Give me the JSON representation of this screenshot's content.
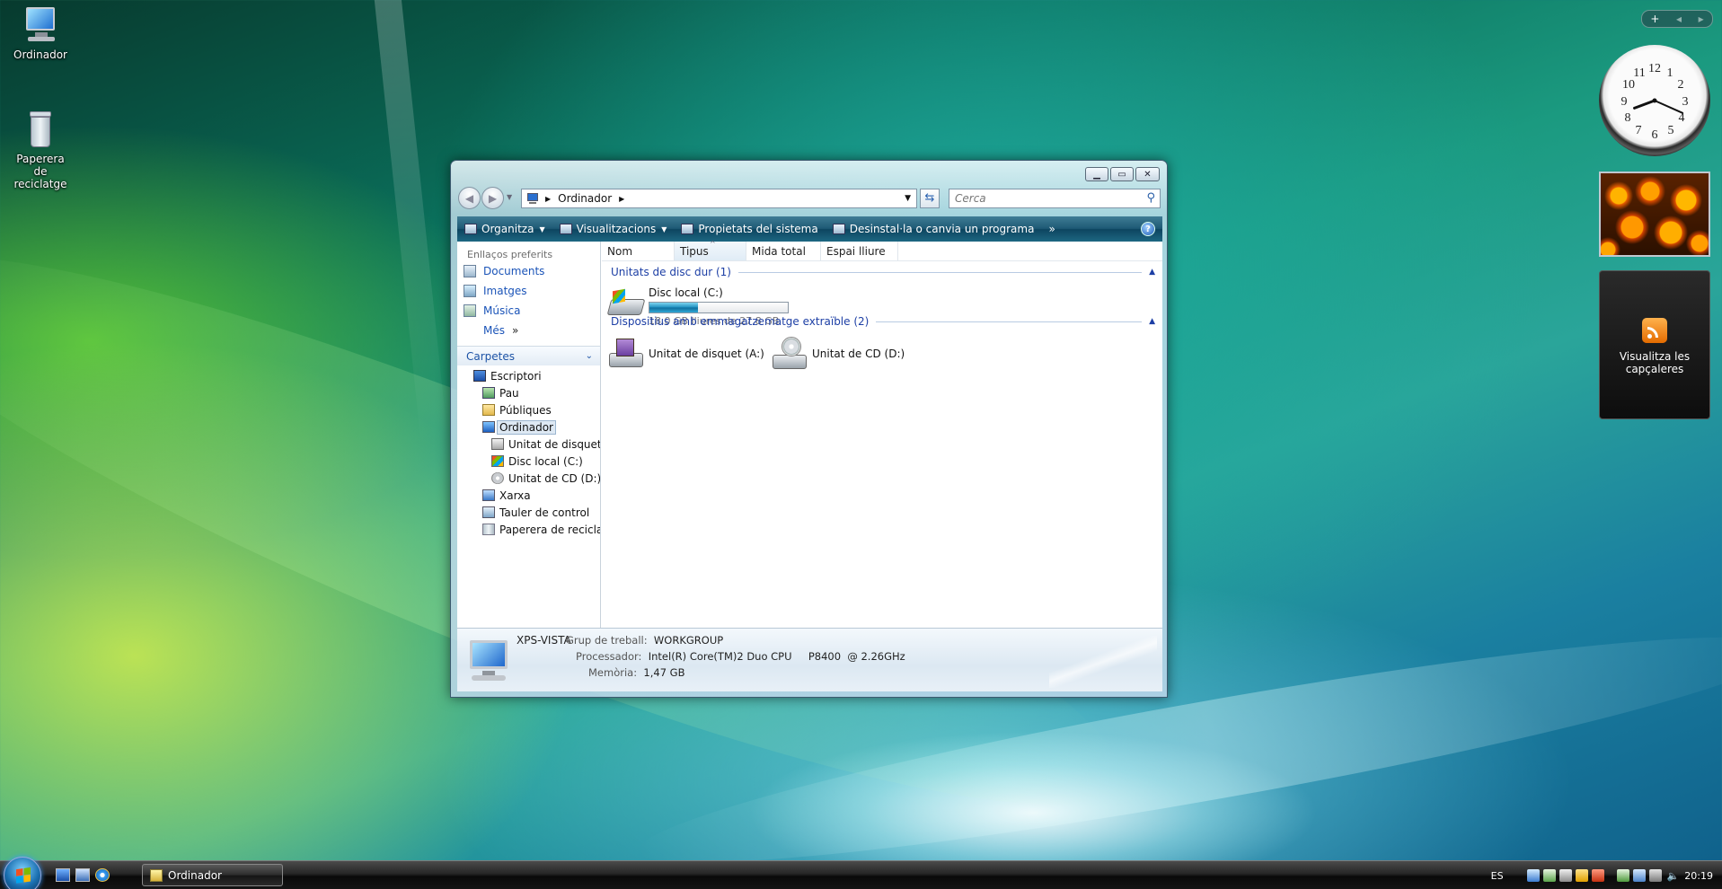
{
  "desktop": {
    "icons": [
      {
        "label": "Ordinador"
      },
      {
        "label": "Paperera de reciclatge"
      }
    ]
  },
  "window": {
    "address": {
      "crumb": "Ordinador"
    },
    "search": {
      "placeholder": "Cerca"
    },
    "toolbar": {
      "organize": "Organitza",
      "views": "Visualitzacions",
      "system_properties": "Propietats del sistema",
      "uninstall": "Desinstal·la o canvia un programa",
      "more": "»"
    },
    "nav": {
      "favorites_title": "Enllaços preferits",
      "favorites": [
        "Documents",
        "Imatges",
        "Música"
      ],
      "more": "Més",
      "more_chev": "»",
      "folders_title": "Carpetes",
      "tree": [
        {
          "label": "Escriptori"
        },
        {
          "label": "Pau"
        },
        {
          "label": "Públiques"
        },
        {
          "label": "Ordinador"
        },
        {
          "label": "Unitat de disquet"
        },
        {
          "label": "Disc local (C:)"
        },
        {
          "label": "Unitat de CD (D:)"
        },
        {
          "label": "Xarxa"
        },
        {
          "label": "Tauler de control"
        },
        {
          "label": "Paperera de reciclat"
        }
      ]
    },
    "columns": [
      "Nom",
      "Tipus",
      "Mida total",
      "Espai lliure"
    ],
    "groups": {
      "hard_disks": "Unitats de disc dur (1)",
      "removable": "Dispositius amb emmagatzematge extraïble (2)"
    },
    "drives": {
      "c": {
        "name": "Disc local (C:)",
        "free_text": "18,0 GB lliures de 27,8 GB",
        "used_fraction": 0.353
      },
      "a": {
        "name": "Unitat de disquet (A:)"
      },
      "d": {
        "name": "Unitat de CD (D:)"
      }
    },
    "details": {
      "name": "XPS-VISTA",
      "workgroup_label": "Grup de treball:",
      "workgroup": "WORKGROUP",
      "processor_label": "Processador:",
      "processor": "Intel(R) Core(TM)2 Duo CPU     P8400  @ 2.26GHz",
      "memory_label": "Memòria:",
      "memory": "1,47 GB"
    }
  },
  "sidebar": {
    "clock": {
      "hour": 8,
      "minute": 19
    },
    "feed_label": "Visualitza les capçaleres"
  },
  "taskbar": {
    "task": "Ordinador",
    "lang": "ES",
    "time": "20:19"
  }
}
